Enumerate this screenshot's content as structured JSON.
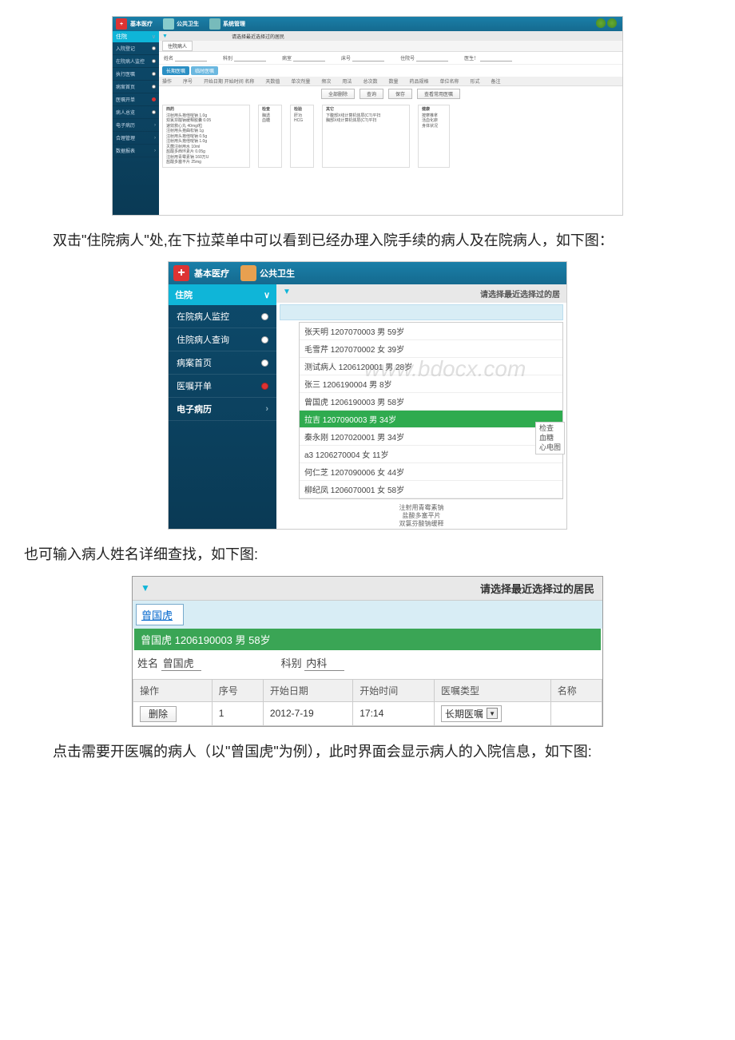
{
  "shot1": {
    "top": {
      "brand": "基本医疗",
      "tab2": "公共卫生",
      "tab3": "系统管理"
    },
    "bar_hint": "请选择最近选择过的居民",
    "side": {
      "header": "住院",
      "items": [
        "入院登记",
        "在院病人监控",
        "执行医嘱",
        "病案首页",
        "医嘱开单",
        "病人总览"
      ],
      "subs": [
        "电子病历",
        "合理管理",
        "数据报表"
      ]
    },
    "tab": "住院病人",
    "fields": {
      "name": "姓名",
      "dept": "科别",
      "ward": "病室",
      "bed": "床号",
      "inno": "住院号",
      "doc": "医生！"
    },
    "pills": [
      "长期医嘱",
      "临时医嘱"
    ],
    "cols": [
      "操作",
      "序号",
      "开始日期 开始时间 名称",
      "天数值",
      "单次剂量",
      "频次",
      "用法",
      "总次数",
      "数量",
      "药品规格",
      "单位名称",
      "形式",
      "备注"
    ],
    "btns": [
      "全部删除",
      "查询",
      "保存",
      "查看常用医嘱"
    ],
    "lists": {
      "c1h": "西药",
      "c1": [
        "注射用头孢他啶钠 1.0g",
        "双氯芬酸钠缓释胶囊 0.05",
        "速效救心丸 40mg/粒",
        "注射用头孢曲松钠 1g",
        "注射用头孢他啶钠 0.5g",
        "注射用头孢他啶钠 1.0g",
        "灭菌注射用水 10ml",
        "盐酸多西环素片 0.05g",
        "注射用青霉素钠 160万U",
        "盐酸多塞平片 25mg"
      ],
      "c2h": "检查",
      "c2": [
        "胸透",
        "血糖"
      ],
      "c3h": "检验",
      "c3": [
        "肝功",
        "HCG"
      ],
      "c4h": "其它",
      "c4": [
        "下腹部X线计算机体层(CT)平扫",
        "胸部X线计算机体层(CT)平扫"
      ],
      "c5h": "健康",
      "c5": [
        "按摩推拿",
        "活血化瘀",
        "身体状况"
      ]
    }
  },
  "para1": "双击\"住院病人\"处,在下拉菜单中可以看到已经办理入院手续的病人及在院病人，如下图：",
  "shot2": {
    "brand": "基本医疗",
    "tab2": "公共卫生",
    "side_header": "住院",
    "side_items": [
      {
        "label": "在院病人监控",
        "dot": "n"
      },
      {
        "label": "住院病人查询",
        "dot": "n"
      },
      {
        "label": "病案首页",
        "dot": "n"
      },
      {
        "label": "医嘱开单",
        "dot": "r"
      }
    ],
    "side_sub": "电子病历",
    "bar_hint": "请选择最近选择过的居",
    "watermark": "www.bdocx.com",
    "dropdown": [
      "张天明 1207070003 男 59岁",
      "毛雪芹 1207070002 女 39岁",
      "测试病人 1206120001 男 28岁",
      "张三 1206190004 男 8岁",
      "曾国虎 1206190003 男 58岁",
      "拉吉 1207090003 男 34岁",
      "秦永刚 1207020001 男 34岁",
      "a3 1206270004 女 11岁",
      "何仁芝 1207090006 女 44岁",
      "柳纪凤 1206070001 女 58岁"
    ],
    "dropdown_selected_index": 5,
    "rbox": {
      "h": "检查",
      "l1": "血糖",
      "l2": "心电图"
    },
    "bot": [
      "注射用青霉素钠",
      "盐酸多塞平片",
      "双氯芬酸钠缓释"
    ]
  },
  "para2": "也可输入病人姓名详细查找，如下图:",
  "shot3": {
    "bar_hint": "请选择最近选择过的居民",
    "input_value": "曾国虎",
    "result": "曾国虎 1206190003 男 58岁",
    "row": {
      "nameLabel": "姓名",
      "nameVal": "曾国虎",
      "deptLabel": "科别",
      "deptVal": "内科"
    },
    "cols": [
      "操作",
      "序号",
      "开始日期",
      "开始时间",
      "医嘱类型",
      "名称"
    ],
    "tr": {
      "del": "删除",
      "seq": "1",
      "date": "2012-7-19",
      "time": "17:14",
      "type": "长期医嘱"
    }
  },
  "para3": "点击需要开医嘱的病人（以\"曾国虎\"为例），此时界面会显示病人的入院信息，如下图:"
}
